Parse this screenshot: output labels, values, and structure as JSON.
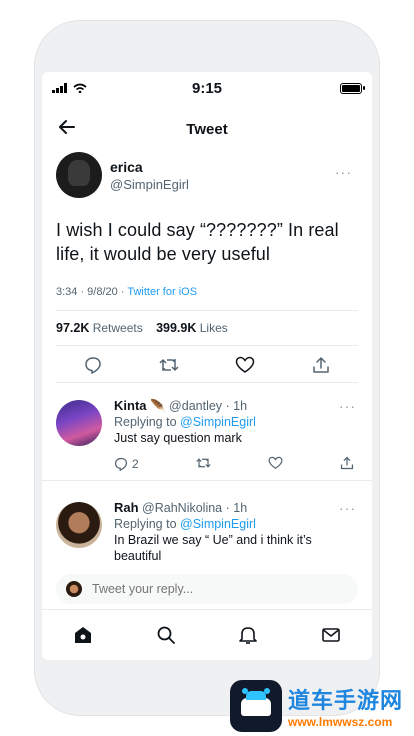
{
  "status_bar": {
    "time": "9:15"
  },
  "header": {
    "title": "Tweet"
  },
  "tweet": {
    "name": "erica",
    "handle": "@SimpinEgirl",
    "text": "I wish I could say “???????” In real life, it would be very useful",
    "time": "3:34 · 9/8/20 · ",
    "source": "Twitter for iOS",
    "retweets_count": "97.2K",
    "retweets_label": "Retweets",
    "likes_count": "399.9K",
    "likes_label": "Likes"
  },
  "replies": [
    {
      "name": "Kinta",
      "emoji": "🪶",
      "handle": "@dantley",
      "time": "· 1h",
      "replying_prefix": "Replying to ",
      "replying_to": "@SimpinEgirl",
      "text": "Just say question mark",
      "reply_count": "2"
    },
    {
      "name": "Rah",
      "handle": "@RahNikolina",
      "time": "· 1h",
      "replying_prefix": "Replying to ",
      "replying_to": "@SimpinEgirl",
      "text": "In Brazil we say “ Ue” and i think it’s beautiful"
    }
  ],
  "compose": {
    "placeholder": "Tweet your reply..."
  },
  "tabbar": [
    "home-icon",
    "search-icon",
    "notifications-icon",
    "messages-icon"
  ],
  "watermark": {
    "text": "道车手游网",
    "url": "www.lmwwsz.com"
  },
  "colors": {
    "accent": "#1d9bf0",
    "text": "#0f1419",
    "secondary": "#536471"
  }
}
